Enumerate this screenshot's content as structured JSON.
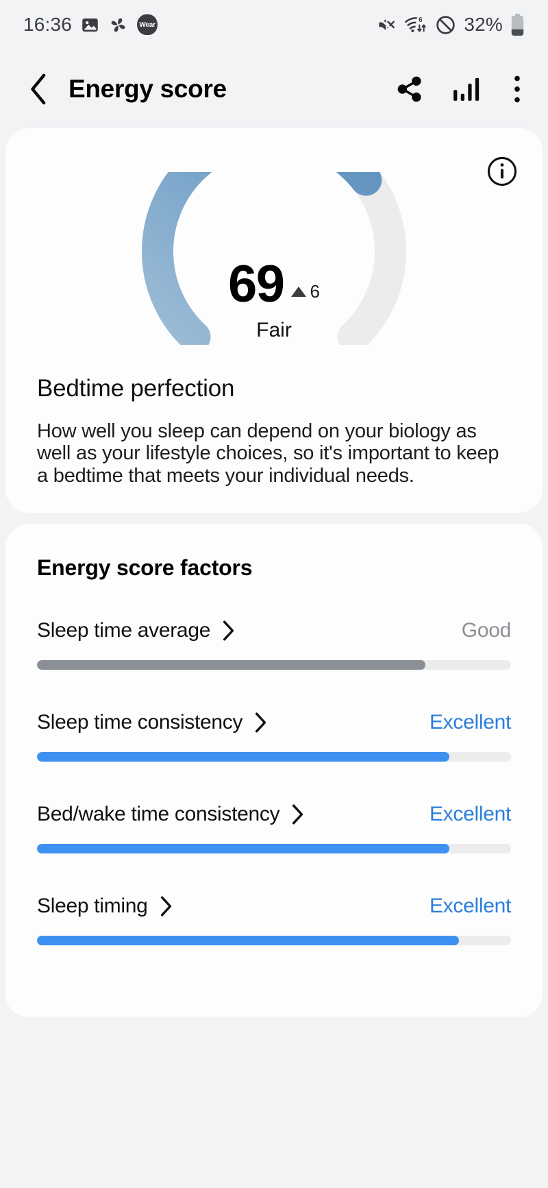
{
  "status_bar": {
    "time": "16:36",
    "left_icons": [
      "image-icon",
      "pinwheel-icon",
      "wear-badge"
    ],
    "wear_label": "Wear",
    "right_icons": [
      "mute-icon",
      "wifi6-icon",
      "do-not-disturb-icon"
    ],
    "battery_percent": "32%"
  },
  "app_bar": {
    "back_icon": "back-chevron-icon",
    "title": "Energy score",
    "actions": [
      "share-icon",
      "bar-chart-icon",
      "overflow-menu-icon"
    ]
  },
  "hero": {
    "info_icon": "info-icon",
    "score": "69",
    "delta_icon": "triangle-up-icon",
    "delta": "6",
    "rating": "Fair",
    "gauge": {
      "value": 69,
      "max": 100,
      "arc_color_start": "#8fb3d2",
      "arc_color_end": "#5d8fbd",
      "track_color": "#ececec"
    },
    "title": "Bedtime perfection",
    "body": "How well you sleep can depend on your biology as well as your lifestyle choices, so it's important to keep a bedtime that meets your individual needs."
  },
  "factors": {
    "title": "Energy score factors",
    "items": [
      {
        "label": "Sleep time average",
        "chevron": "chevron-right-icon",
        "rating": "Good",
        "rating_color": "#8b8f94",
        "percent": 82,
        "bar_class": "fill-gray"
      },
      {
        "label": "Sleep time consistency",
        "chevron": "chevron-right-icon",
        "rating": "Excellent",
        "rating_color": "#2a7fdd",
        "percent": 87,
        "bar_class": "fill-blue"
      },
      {
        "label": "Bed/wake time consistency",
        "chevron": "chevron-right-icon",
        "rating": "Excellent",
        "rating_color": "#2a7fdd",
        "percent": 87,
        "bar_class": "fill-blue"
      },
      {
        "label": "Sleep timing",
        "chevron": "chevron-right-icon",
        "rating": "Excellent",
        "rating_color": "#2a7fdd",
        "percent": 89,
        "bar_class": "fill-blue"
      }
    ]
  }
}
